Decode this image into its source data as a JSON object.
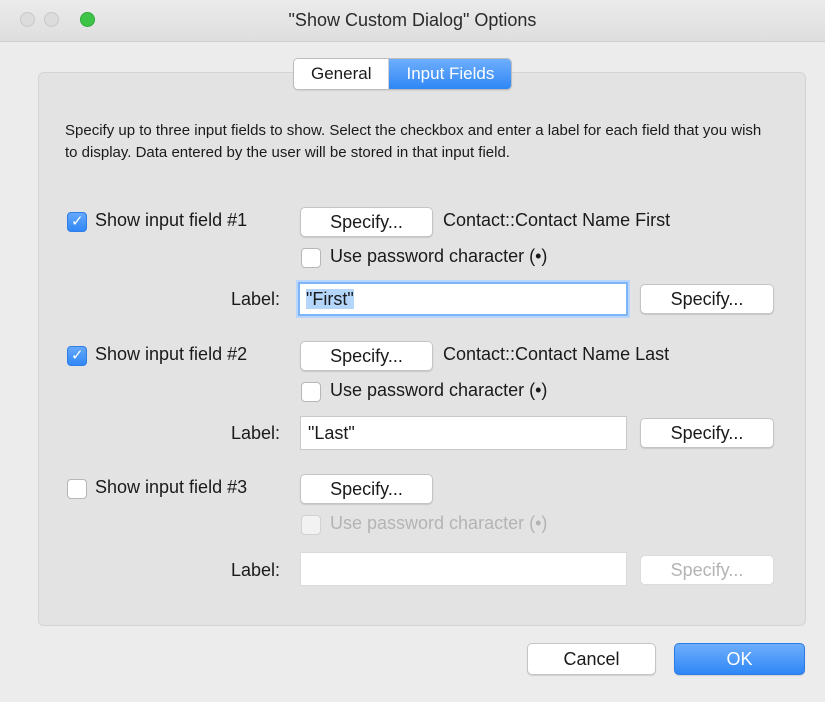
{
  "window": {
    "title": "\"Show Custom Dialog\" Options"
  },
  "tabs": [
    {
      "label": "General",
      "active": false
    },
    {
      "label": "Input Fields",
      "active": true
    }
  ],
  "description": "Specify up to three input fields to show. Select the checkbox and enter a label for each field that you wish to display. Data entered by the user will be stored in that input field.",
  "fields": [
    {
      "show_label": "Show input field #1",
      "checked": true,
      "specify_label": "Specify...",
      "target": "Contact::Contact Name First",
      "password_label": "Use password character (•)",
      "password_checked": false,
      "label_caption": "Label:",
      "label_value": "\"First\"",
      "label_specify": "Specify..."
    },
    {
      "show_label": "Show input field #2",
      "checked": true,
      "specify_label": "Specify...",
      "target": "Contact::Contact Name Last",
      "password_label": "Use password character (•)",
      "password_checked": false,
      "label_caption": "Label:",
      "label_value": "\"Last\"",
      "label_specify": "Specify..."
    },
    {
      "show_label": "Show input field #3",
      "checked": false,
      "specify_label": "Specify...",
      "target": "",
      "password_label": "Use password character (•)",
      "password_checked": false,
      "label_caption": "Label:",
      "label_value": "",
      "label_specify": "Specify..."
    }
  ],
  "buttons": {
    "cancel": "Cancel",
    "ok": "OK"
  },
  "colors": {
    "accent": "#2f87f6",
    "focus_ring": "#7db4f6",
    "zoom_button": "#3ec547"
  }
}
